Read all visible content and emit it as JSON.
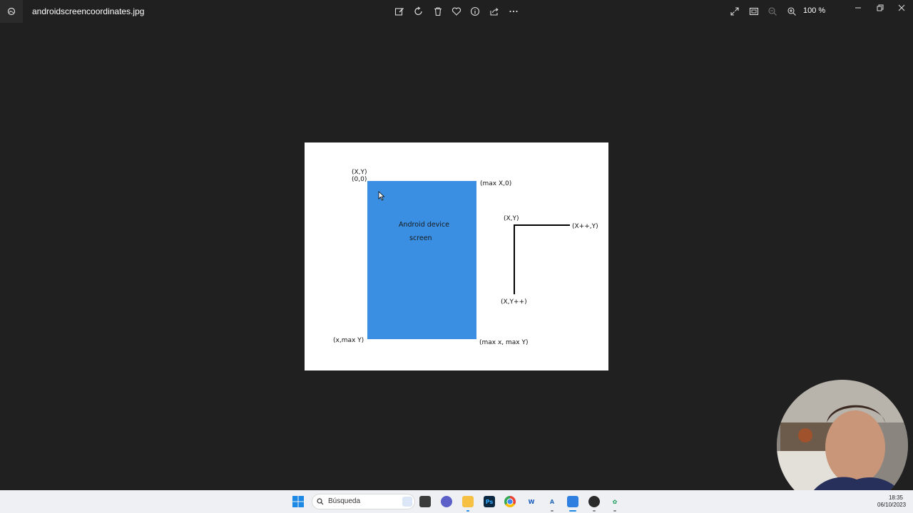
{
  "window": {
    "file_name": "androidscreencoordinates.jpg",
    "zoom_label": "100 %"
  },
  "toolbar": {
    "icons": [
      "edit-image-icon",
      "rotate-icon",
      "delete-icon",
      "favorite-icon",
      "info-icon",
      "share-icon",
      "more-icon"
    ],
    "right_icons": [
      "full-screen-icon",
      "fit-window-icon",
      "zoom-out-icon",
      "zoom-in-icon"
    ]
  },
  "image": {
    "origin_xy_label": "(X,Y)",
    "origin_zero_label": "(0,0)",
    "top_right_label": "(max X,0)",
    "bottom_left_label": "(x,max Y)",
    "bottom_right_label": "(max x, max Y)",
    "screen_text_line1": "Android device",
    "screen_text_line2": "screen",
    "axis_origin_label": "(X,Y)",
    "axis_x_label": "(X++,Y)",
    "axis_y_label": "(X,Y++)",
    "screen_color": "#3a8fe2"
  },
  "taskbar": {
    "search_placeholder": "Búsqueda",
    "apps": [
      "windows-start-icon",
      "file-manager-icon",
      "teams-chat-icon",
      "folder-icon",
      "photoshop-icon",
      "chrome-icon",
      "word-icon",
      "app-icon",
      "photos-icon",
      "obs-icon",
      "app-green-icon"
    ],
    "time": "18:35",
    "date": "06/10/2023"
  }
}
